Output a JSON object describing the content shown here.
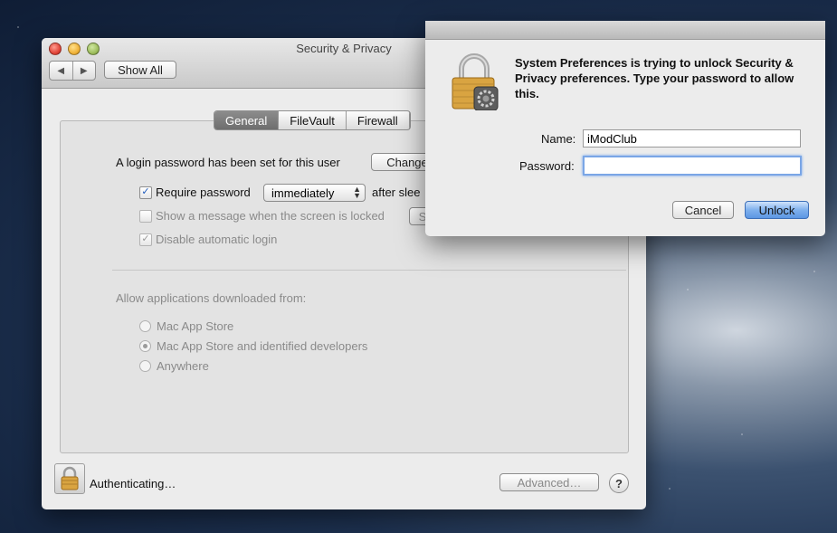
{
  "window": {
    "title": "Security & Privacy",
    "nav_back": "◀",
    "nav_forward": "▶",
    "show_all": "Show All"
  },
  "tabs": [
    {
      "label": "General",
      "active": true
    },
    {
      "label": "FileVault",
      "active": false
    },
    {
      "label": "Firewall",
      "active": false
    }
  ],
  "general": {
    "password_set_text": "A login password has been set for this user",
    "change_button": "Change",
    "require_password_label": "Require password",
    "require_password_checked": true,
    "require_password_select": "immediately",
    "after_sleep_text": "after slee",
    "show_message_label": "Show a message when the screen is locked",
    "show_message_checked": false,
    "set_lock_button_partial": "S",
    "disable_auto_login_label": "Disable automatic login",
    "disable_auto_login_checked": true,
    "allow_apps_heading": "Allow applications downloaded from:",
    "options": [
      {
        "label": "Mac App Store",
        "selected": false
      },
      {
        "label": "Mac App Store and identified developers",
        "selected": true
      },
      {
        "label": "Anywhere",
        "selected": false
      }
    ]
  },
  "footer": {
    "status": "Authenticating…",
    "advanced_button": "Advanced…",
    "help": "?"
  },
  "dialog": {
    "message": "System Preferences is trying to unlock Security & Privacy preferences. Type your password to allow this.",
    "name_label": "Name:",
    "name_value": "iModClub",
    "password_label": "Password:",
    "password_value": "",
    "cancel_button": "Cancel",
    "unlock_button": "Unlock"
  },
  "colors": {
    "accent_blue": "#5c97e4",
    "lock_gold": "#d9a441"
  }
}
